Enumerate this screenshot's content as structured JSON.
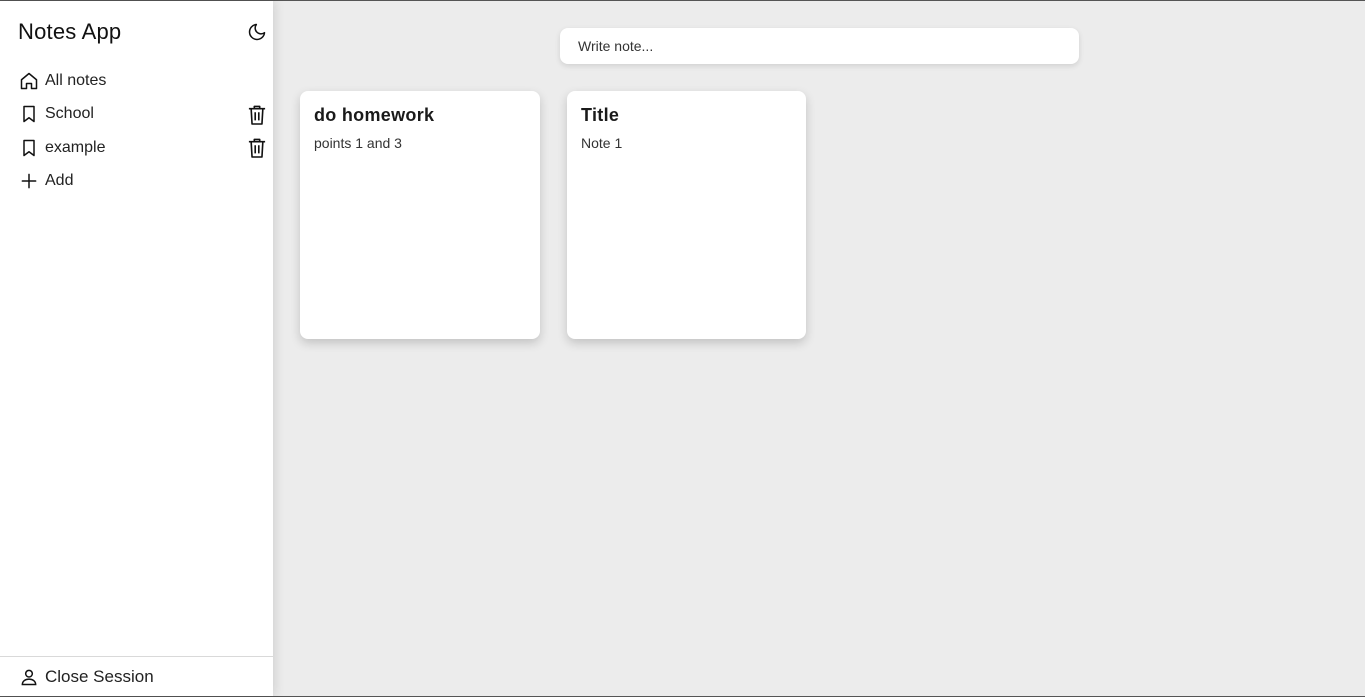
{
  "app": {
    "title": "Notes App"
  },
  "sidebar": {
    "items": [
      {
        "label": "All notes",
        "icon": "home-icon",
        "deletable": false
      },
      {
        "label": "School",
        "icon": "bookmark-icon",
        "deletable": true
      },
      {
        "label": "example",
        "icon": "bookmark-icon",
        "deletable": true
      },
      {
        "label": "Add",
        "icon": "plus-icon",
        "deletable": false
      }
    ],
    "footer_label": "Close Session"
  },
  "search": {
    "placeholder": "Write note..."
  },
  "notes": [
    {
      "title": "do homework",
      "body": "points 1 and 3"
    },
    {
      "title": "Title",
      "body": "Note 1"
    }
  ],
  "icons": {
    "theme": "moon-icon",
    "delete": "trash-icon",
    "user": "user-icon"
  }
}
